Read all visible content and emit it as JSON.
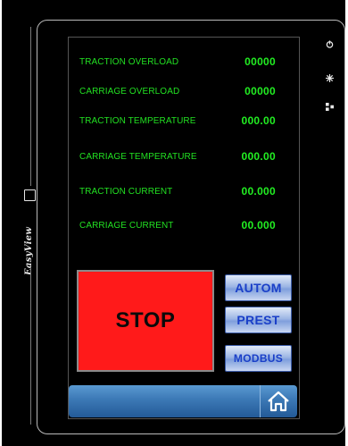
{
  "brand": {
    "name": "EasyView"
  },
  "readings": [
    {
      "label": "TRACTION OVERLOAD",
      "value": "00000"
    },
    {
      "label": "CARRIAGE OVERLOAD",
      "value": "00000"
    },
    {
      "label": "TRACTION TEMPERATURE",
      "value": "000.00"
    },
    {
      "label": "CARRIAGE TEMPERATURE",
      "value": "000.00"
    },
    {
      "label": "TRACTION CURRENT",
      "value": "00.000"
    },
    {
      "label": "CARRIAGE CURRENT",
      "value": "00.000"
    }
  ],
  "controls": {
    "stop_label": "STOP",
    "autom_label": "AUTOM",
    "prest_label": "PREST",
    "modbus_label": "MODBUS"
  },
  "icons": {
    "power": "power-icon",
    "brightness": "brightness-icon",
    "network": "network-icon",
    "home": "home-icon"
  },
  "colors": {
    "value_green": "#22ee22",
    "stop_red": "#ff1a1a",
    "button_blue_text": "#1a3fc8",
    "bar_blue": "#3e7bb8"
  }
}
